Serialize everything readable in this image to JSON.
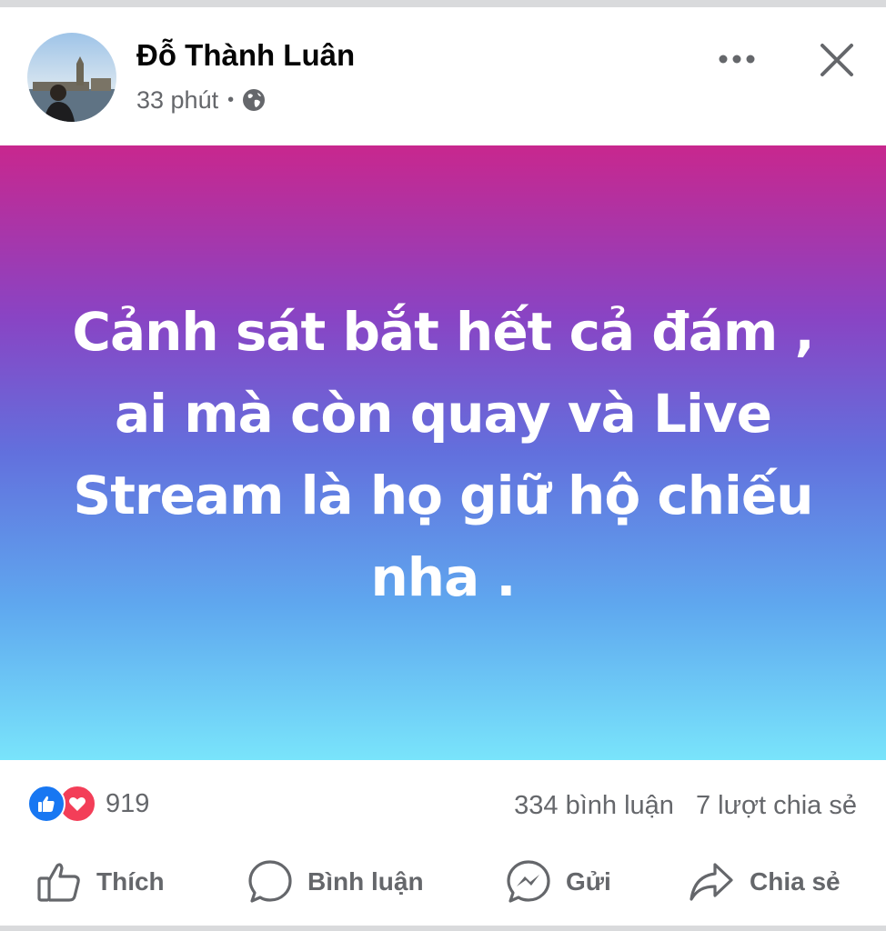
{
  "post": {
    "author_name": "Đỗ Thành Luân",
    "time_ago": "33 phút",
    "separator": "•",
    "privacy_icon": "globe-icon",
    "content_text": "Cảnh sát bắt hết cả đám , ai mà còn quay và Live Stream là họ giữ hộ chiếu nha .",
    "background_gradient": [
      "#c8278e",
      "#8944c4",
      "#6270dd",
      "#5fa8ef",
      "#79e4fb"
    ],
    "text_color": "#ffffff"
  },
  "header_actions": {
    "more_icon": "more-dots-icon",
    "close_icon": "close-icon"
  },
  "stats": {
    "reaction_icons": [
      "like-icon",
      "love-icon"
    ],
    "reaction_count": "919",
    "comments": "334 bình luận",
    "shares": "7 lượt chia sẻ"
  },
  "actions": {
    "like_label": "Thích",
    "comment_label": "Bình luận",
    "send_label": "Gửi",
    "share_label": "Chia sẻ"
  },
  "colors": {
    "like_blue": "#1877f2",
    "love_red": "#f33e58",
    "secondary_text": "#65676b"
  }
}
